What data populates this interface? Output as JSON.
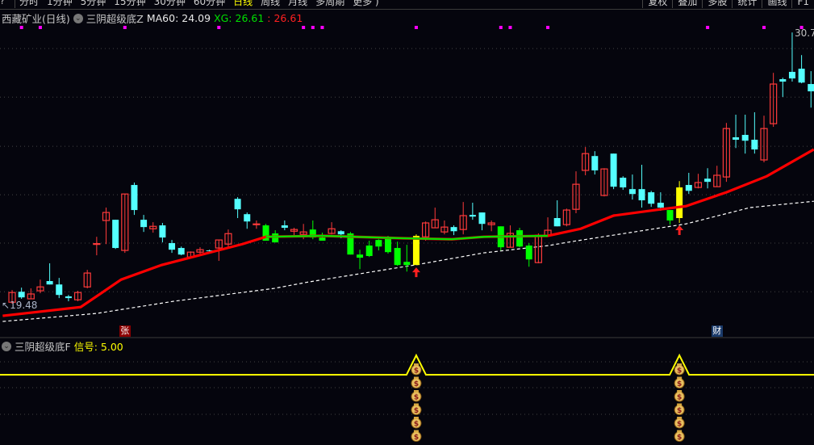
{
  "topbar": {
    "left_icon": "?",
    "periods": [
      "分时",
      "1分钟",
      "5分钟",
      "15分钟",
      "30分钟",
      "60分钟",
      "日线",
      "周线",
      "月线",
      "多周期",
      "更多 )"
    ],
    "active_period": "日线",
    "right_buttons": [
      "复权",
      "叠加",
      "多股",
      "统计",
      "画线",
      "F1"
    ]
  },
  "main_panel": {
    "stock_name": "西藏矿业(日线)",
    "indicator_name": "三阴超级底Z",
    "ma60_label": "MA60: 24.09",
    "xg_label": "XG: 26.61",
    "xg_value2": ": 26.61",
    "high_label": "30.7",
    "low_label": "19.48",
    "colors": {
      "up": "#ff3a3a",
      "down": "#54ffff",
      "signal_down": "#00ff00",
      "signal_up": "#ffff00",
      "ma_red": "#ff0000",
      "ma_green": "#00e000",
      "ma60": "#ffffff",
      "dot": "#ff00ff",
      "background": "#05050d"
    }
  },
  "badges": [
    {
      "text": "张",
      "candle": 12,
      "color": "#8b0000"
    },
    {
      "text": "财",
      "candle": 75,
      "color": "#1a3a6a"
    }
  ],
  "lower_panel": {
    "indicator_name": "三阴超级底F",
    "signal_label": "信号: 5.00",
    "line_color": "#ffff00",
    "money_bag_count": 6,
    "icon": "money-bag-icon"
  },
  "chart_data": {
    "type": "candlestick",
    "y_range": [
      18.7,
      31.1
    ],
    "grid": true,
    "grid_values": [
      30.1,
      28.1,
      26.08,
      24.09,
      22.1,
      20.1
    ],
    "candles_ohlc_mark": [
      [
        19.67,
        20.17,
        19.61,
        20.07,
        ""
      ],
      [
        20.1,
        20.27,
        19.81,
        19.87,
        ""
      ],
      [
        19.81,
        20.24,
        19.81,
        20.01,
        ""
      ],
      [
        20.14,
        20.6,
        20.04,
        20.3,
        ""
      ],
      [
        20.54,
        21.27,
        20.4,
        20.4,
        ""
      ],
      [
        20.4,
        20.67,
        19.84,
        19.97,
        ""
      ],
      [
        19.91,
        19.97,
        19.71,
        19.84,
        ""
      ],
      [
        19.77,
        20.14,
        19.71,
        20.07,
        ""
      ],
      [
        20.3,
        21.0,
        20.24,
        20.87,
        ""
      ],
      [
        22.06,
        22.36,
        21.6,
        22.08,
        ""
      ],
      [
        23.03,
        23.56,
        22.06,
        23.36,
        ""
      ],
      [
        23.06,
        23.06,
        21.86,
        21.9,
        ""
      ],
      [
        21.8,
        24.12,
        21.7,
        24.12,
        ""
      ],
      [
        24.49,
        24.59,
        23.26,
        23.46,
        ""
      ],
      [
        23.06,
        23.26,
        22.56,
        22.76,
        ""
      ],
      [
        22.69,
        22.96,
        22.53,
        22.79,
        ""
      ],
      [
        22.83,
        22.93,
        22.13,
        22.33,
        ""
      ],
      [
        22.1,
        22.23,
        21.7,
        21.83,
        ""
      ],
      [
        21.9,
        21.96,
        21.6,
        21.63,
        ""
      ],
      [
        21.53,
        21.76,
        21.47,
        21.73,
        ""
      ],
      [
        21.73,
        21.93,
        21.67,
        21.83,
        ""
      ],
      [
        21.8,
        21.83,
        21.7,
        21.77,
        ""
      ],
      [
        21.9,
        22.23,
        21.37,
        22.23,
        ""
      ],
      [
        22.06,
        22.66,
        21.93,
        22.49,
        ""
      ],
      [
        23.92,
        23.99,
        23.13,
        23.49,
        ""
      ],
      [
        23.29,
        23.36,
        22.69,
        22.99,
        ""
      ],
      [
        22.86,
        23.03,
        22.69,
        22.89,
        ""
      ],
      [
        22.83,
        22.89,
        22.2,
        22.2,
        "g"
      ],
      [
        22.5,
        22.63,
        22.13,
        22.13,
        "g"
      ],
      [
        22.83,
        23.03,
        22.63,
        22.73,
        ""
      ],
      [
        22.59,
        22.73,
        22.36,
        22.66,
        ""
      ],
      [
        22.46,
        22.89,
        22.26,
        22.56,
        ""
      ],
      [
        22.66,
        23.03,
        22.26,
        22.33,
        "g"
      ],
      [
        22.33,
        22.53,
        22.2,
        22.2,
        "g"
      ],
      [
        22.5,
        22.96,
        22.46,
        22.69,
        ""
      ],
      [
        22.59,
        22.63,
        22.3,
        22.46,
        ""
      ],
      [
        22.5,
        22.56,
        21.63,
        21.63,
        "g"
      ],
      [
        21.63,
        21.83,
        21.03,
        21.5,
        "g"
      ],
      [
        22.0,
        22.2,
        21.53,
        21.57,
        "g"
      ],
      [
        22.23,
        22.26,
        21.8,
        21.96,
        "g"
      ],
      [
        22.33,
        22.4,
        21.67,
        21.73,
        "g"
      ],
      [
        21.9,
        22.16,
        21.17,
        21.2,
        "g"
      ],
      [
        21.33,
        22.03,
        20.93,
        21.2,
        "g"
      ],
      [
        21.2,
        22.46,
        21.2,
        22.4,
        "y"
      ],
      [
        22.36,
        22.99,
        22.2,
        22.93,
        ""
      ],
      [
        22.73,
        23.56,
        22.73,
        23.06,
        ""
      ],
      [
        22.56,
        23.03,
        22.46,
        22.76,
        ""
      ],
      [
        22.76,
        22.83,
        22.43,
        22.59,
        ""
      ],
      [
        22.66,
        23.79,
        22.46,
        23.23,
        ""
      ],
      [
        23.26,
        23.76,
        23.06,
        23.19,
        ""
      ],
      [
        23.36,
        23.36,
        22.63,
        22.89,
        ""
      ],
      [
        22.86,
        23.03,
        22.59,
        22.93,
        ""
      ],
      [
        22.79,
        22.79,
        21.8,
        21.93,
        "g"
      ],
      [
        21.93,
        22.83,
        21.93,
        22.5,
        ""
      ],
      [
        22.63,
        22.73,
        21.93,
        21.96,
        "g"
      ],
      [
        22.0,
        22.1,
        21.13,
        21.43,
        "g"
      ],
      [
        21.3,
        22.5,
        21.27,
        22.43,
        ""
      ],
      [
        22.43,
        23.16,
        22.4,
        22.63,
        ""
      ],
      [
        23.13,
        23.86,
        22.79,
        22.79,
        ""
      ],
      [
        22.86,
        23.52,
        22.79,
        23.46,
        ""
      ],
      [
        23.49,
        25.05,
        23.33,
        24.52,
        ""
      ],
      [
        25.09,
        26.05,
        24.89,
        25.78,
        ""
      ],
      [
        25.68,
        25.88,
        24.92,
        25.09,
        ""
      ],
      [
        24.06,
        25.18,
        24.02,
        25.15,
        ""
      ],
      [
        25.78,
        25.78,
        24.32,
        24.42,
        ""
      ],
      [
        24.79,
        24.85,
        24.29,
        24.39,
        ""
      ],
      [
        24.32,
        24.92,
        23.89,
        24.12,
        ""
      ],
      [
        24.32,
        25.32,
        23.56,
        23.86,
        ""
      ],
      [
        24.19,
        24.25,
        23.59,
        23.72,
        ""
      ],
      [
        23.76,
        24.19,
        23.43,
        23.56,
        ""
      ],
      [
        23.46,
        23.46,
        22.86,
        23.03,
        "g"
      ],
      [
        23.13,
        24.65,
        22.93,
        24.39,
        "y"
      ],
      [
        24.49,
        24.99,
        24.12,
        24.25,
        ""
      ],
      [
        24.39,
        24.95,
        24.35,
        24.59,
        ""
      ],
      [
        24.75,
        25.18,
        24.35,
        24.62,
        ""
      ],
      [
        24.42,
        25.28,
        24.42,
        24.89,
        ""
      ],
      [
        24.82,
        27.04,
        24.62,
        26.81,
        ""
      ],
      [
        26.45,
        27.38,
        26.01,
        26.35,
        ""
      ],
      [
        26.55,
        27.38,
        25.78,
        26.31,
        ""
      ],
      [
        26.35,
        27.48,
        25.78,
        25.95,
        ""
      ],
      [
        25.52,
        27.34,
        25.42,
        26.81,
        ""
      ],
      [
        27.01,
        29.1,
        26.88,
        28.64,
        ""
      ],
      [
        28.84,
        28.9,
        28.11,
        28.74,
        ""
      ],
      [
        29.14,
        30.76,
        28.74,
        28.87,
        ""
      ],
      [
        29.27,
        29.83,
        28.67,
        28.7,
        ""
      ],
      [
        28.64,
        29.17,
        27.67,
        28.34,
        ""
      ]
    ],
    "ma_red": [
      [
        -1,
        19.11
      ],
      [
        7.3,
        19.47
      ],
      [
        11.6,
        20.6
      ],
      [
        15.9,
        21.2
      ],
      [
        20.2,
        21.63
      ],
      [
        24.5,
        22.06
      ],
      [
        27,
        22.36
      ],
      [
        33,
        22.4
      ],
      [
        41.6,
        22.3
      ],
      [
        46.8,
        22.26
      ],
      [
        50.2,
        22.36
      ],
      [
        57,
        22.4
      ],
      [
        60.5,
        22.69
      ],
      [
        64,
        23.23
      ],
      [
        69,
        23.49
      ],
      [
        71.7,
        23.62
      ],
      [
        76,
        24.19
      ],
      [
        80.3,
        24.85
      ],
      [
        85.3,
        25.95
      ]
    ],
    "ma_green_range": [
      27,
      57
    ],
    "ma60": [
      [
        -1,
        18.88
      ],
      [
        9,
        19.21
      ],
      [
        17.2,
        19.71
      ],
      [
        27.9,
        20.24
      ],
      [
        31.5,
        20.5
      ],
      [
        43.3,
        21.23
      ],
      [
        50.2,
        21.7
      ],
      [
        57.1,
        22.0
      ],
      [
        59.5,
        22.16
      ],
      [
        71.7,
        22.89
      ],
      [
        78.5,
        23.56
      ],
      [
        85.3,
        23.82
      ]
    ],
    "dot_marks": [
      1,
      3,
      12,
      22,
      31,
      32,
      33,
      43,
      52,
      53,
      57,
      74,
      80,
      84
    ],
    "signal_candles": [
      43,
      71
    ],
    "signal_value": 5
  }
}
